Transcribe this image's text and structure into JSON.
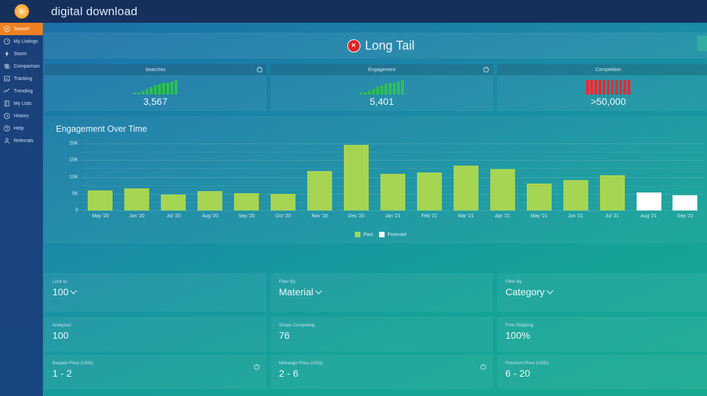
{
  "app": {
    "title": "digital download",
    "logo_icon": "citrus-slice-logo"
  },
  "sidebar": {
    "items": [
      {
        "label": "Search",
        "icon": "compass-icon",
        "active": true
      },
      {
        "label": "My Listings",
        "icon": "clock-dial-icon",
        "active": false
      },
      {
        "label": "Storm",
        "icon": "lightning-icon",
        "active": false
      },
      {
        "label": "Comparison",
        "icon": "signpost-icon",
        "active": false
      },
      {
        "label": "Tracking",
        "icon": "bar-chart-icon",
        "active": false
      },
      {
        "label": "Trending",
        "icon": "trend-line-icon",
        "active": false
      },
      {
        "label": "My Lists",
        "icon": "list-panel-icon",
        "active": false
      },
      {
        "label": "History",
        "icon": "clock-icon",
        "active": false
      },
      {
        "label": "Help",
        "icon": "question-icon",
        "active": false
      },
      {
        "label": "Referrals",
        "icon": "person-icon",
        "active": false
      }
    ]
  },
  "banner": {
    "title": "Long Tail",
    "badge_icon": "red-x-circle-icon",
    "badge_glyph": "×"
  },
  "metrics": [
    {
      "label": "Searches",
      "value": "3,567",
      "spark_color": "#2cc24f",
      "info_icon": "info-question-icon",
      "has_info": true,
      "spark": [
        3,
        3,
        5,
        8,
        11,
        13,
        15,
        17,
        17,
        19,
        21
      ]
    },
    {
      "label": "Engagement",
      "value": "5,401",
      "spark_color": "#2cc24f",
      "info_icon": "info-question-icon",
      "has_info": true,
      "spark": [
        3,
        3,
        5,
        8,
        11,
        13,
        15,
        17,
        17,
        19,
        21
      ]
    },
    {
      "label": "Competition",
      "value": ">50,000",
      "spark_color": "#f4242f",
      "info_icon": "info-question-icon",
      "has_info": false,
      "spark": [
        21,
        21,
        21,
        21,
        21,
        21,
        21,
        21,
        21,
        21,
        21
      ]
    }
  ],
  "chart_data": {
    "type": "bar",
    "title": "Engagement Over Time",
    "xlabel": "",
    "ylabel": "",
    "ylim": [
      0,
      20000
    ],
    "yticks": [
      0,
      5000,
      10000,
      15000,
      20000
    ],
    "ytick_labels": [
      "0",
      "5K",
      "10K",
      "15K",
      "20K"
    ],
    "grid": true,
    "legend_position": "bottom-center",
    "legend": [
      {
        "name": "Past",
        "color": "#a6d553"
      },
      {
        "name": "Forecast",
        "color": "#ffffff"
      }
    ],
    "categories": [
      "May '20",
      "Jun '20",
      "Jul '20",
      "Aug '20",
      "Sep '20",
      "Oct '20",
      "Nov '20",
      "Dec '20",
      "Jan '21",
      "Feb '21",
      "Mar '21",
      "Apr '21",
      "May '21",
      "Jun '21",
      "Jul '21",
      "Aug '21",
      "Sep '21"
    ],
    "values": [
      5900,
      6700,
      4700,
      5800,
      5100,
      5000,
      11800,
      19600,
      10900,
      11400,
      13400,
      12300,
      8100,
      9000,
      10600,
      5300,
      4600
    ],
    "kinds": [
      "past",
      "past",
      "past",
      "past",
      "past",
      "past",
      "past",
      "past",
      "past",
      "past",
      "past",
      "past",
      "past",
      "past",
      "past",
      "forecast",
      "forecast"
    ]
  },
  "filters": [
    {
      "label": "Limit to",
      "value": "100",
      "chevron_icon": "chevron-down-icon"
    },
    {
      "label": "Filter By",
      "value": "Material",
      "chevron_icon": "chevron-down-icon"
    },
    {
      "label": "Filter By",
      "value": "Category",
      "chevron_icon": "chevron-down-icon"
    }
  ],
  "stats": [
    {
      "label": "Analyzed",
      "value": "100",
      "has_info": false
    },
    {
      "label": "Shops Competing",
      "value": "76",
      "has_info": false
    },
    {
      "label": "Free Shipping",
      "value": "100%",
      "has_info": false
    }
  ],
  "prices": [
    {
      "label": "Bargain Price (USD)",
      "value": "1 - 2",
      "has_info": true,
      "info_icon": "info-question-icon"
    },
    {
      "label": "Midrange Price (USD)",
      "value": "2 - 6",
      "has_info": true,
      "info_icon": "info-question-icon"
    },
    {
      "label": "Premium Price (USD)",
      "value": "6 - 20",
      "has_info": false,
      "info_icon": "info-question-icon"
    }
  ],
  "colors": {
    "accent_orange": "#ef8022",
    "bar_past": "#a6d553",
    "bar_forecast": "#ffffff",
    "spark_green": "#2cc24f",
    "spark_red": "#f4242f",
    "sidebar_blue": "#1a437e",
    "topbar_navy": "#16305c"
  }
}
